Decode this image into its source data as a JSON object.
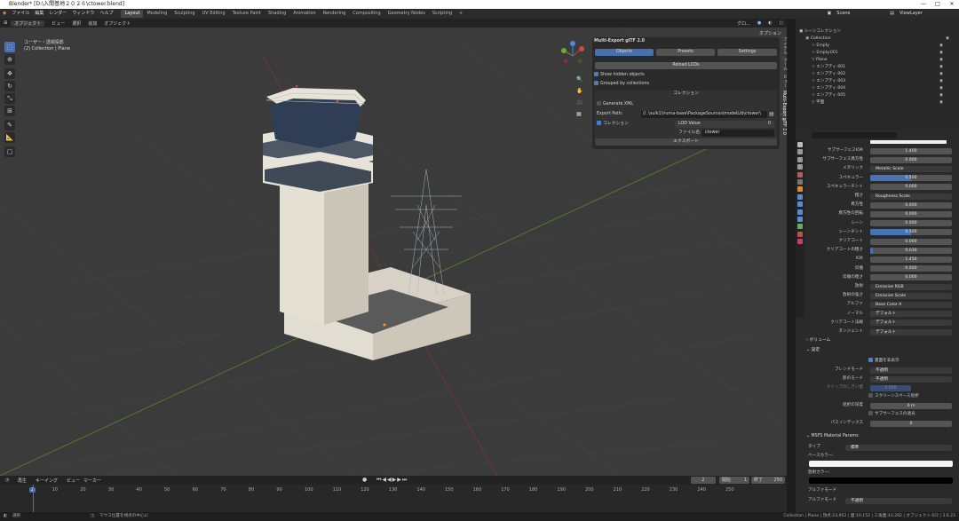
{
  "titlebar": {
    "title": "Blender* [D:\\入間基地２０２６\\ctower.blend]",
    "min": "—",
    "max": "□",
    "close": "✕"
  },
  "menu": [
    "ファイル",
    "編集",
    "レンダー",
    "ウィンドウ",
    "ヘルプ"
  ],
  "workspaces": [
    "Layout",
    "Modeling",
    "Sculpting",
    "UV Editing",
    "Texture Paint",
    "Shading",
    "Animation",
    "Rendering",
    "Compositing",
    "Geometry Nodes",
    "Scripting",
    "+"
  ],
  "scene": {
    "name": "Scene",
    "view_layer": "ViewLayer"
  },
  "viewport_header": [
    "オブジェクト",
    "ビュー",
    "選択",
    "追加",
    "オブジェクト"
  ],
  "viewport_header_right": {
    "transform": "グロ...",
    "options": "オプション"
  },
  "viewport_info": {
    "view": "ユーザー・透視投影",
    "collection": "(2) Collection | Plane"
  },
  "multi_export": {
    "title": "Multi-Export glTF 2.0",
    "tabs": [
      "Objects",
      "Presets",
      "Settings"
    ],
    "reload": "Reload LODs",
    "show_hidden": "Show hidden objects",
    "grouped": "Grouped by collections",
    "section": "コレクション",
    "generate_xml": "Generate XML",
    "export_path_label": "Export Path:",
    "export_path": "//..\\sulk1\\iruma-base\\PackageSources\\modelLib\\ctower\\",
    "collection_label": "コレクション",
    "lod_label": "LOD Value",
    "lod_value": "0",
    "filename_label": "ファイル名:",
    "filename": "ctower",
    "export_btn": "エクスポート"
  },
  "side_tabs": [
    "アイテム",
    "ツール",
    "ビュー",
    "Multi-Export glTF 2.0"
  ],
  "outliner": {
    "header": "シーンコレクション",
    "rows": [
      {
        "label": "Collection",
        "color": "#ccc"
      },
      {
        "label": "Empty",
        "color": "#ccc"
      },
      {
        "label": "Empty.001",
        "color": "#ccc"
      },
      {
        "label": "Plane",
        "color": "#e0e0e0"
      },
      {
        "label": "エンプティ.001",
        "color": "#ccc"
      },
      {
        "label": "エンプティ.002",
        "color": "#ccc"
      },
      {
        "label": "エンプティ.003",
        "color": "#ccc"
      },
      {
        "label": "エンプティ.004",
        "color": "#ccc"
      },
      {
        "label": "エンプティ.005",
        "color": "#ccc"
      },
      {
        "label": "平面",
        "color": "#e0e0e0"
      }
    ]
  },
  "props": {
    "rows": [
      {
        "label": "サブサーフェスIOR",
        "value": "1.400",
        "fill": 0
      },
      {
        "label": "サブサーフェス異方性",
        "value": "0.000",
        "fill": 0
      },
      {
        "label": "メタリック",
        "value": "Metallic Scale",
        "dark": true
      },
      {
        "label": "スペキュラー",
        "value": "0.500",
        "fill": 0.5
      },
      {
        "label": "スペキュラーチント",
        "value": "0.000",
        "fill": 0
      },
      {
        "label": "粗さ",
        "value": "Roughness Scale",
        "dark": true
      },
      {
        "label": "異方性",
        "value": "0.000",
        "fill": 0
      },
      {
        "label": "異方性の回転",
        "value": "0.000",
        "fill": 0
      },
      {
        "label": "シーン",
        "value": "0.000",
        "fill": 0
      },
      {
        "label": "シーンチント",
        "value": "0.500",
        "fill": 0.5
      },
      {
        "label": "クリアコート",
        "value": "0.000",
        "fill": 0
      },
      {
        "label": "クリアコートの粗さ",
        "value": "0.030",
        "fill": 0.03
      },
      {
        "label": "IOR",
        "value": "1.450",
        "fill": 0
      },
      {
        "label": "伝播",
        "value": "0.000",
        "fill": 0
      },
      {
        "label": "伝播の粗さ",
        "value": "0.000",
        "fill": 0
      },
      {
        "label": "放射",
        "value": "Emissive RGB",
        "dark": true
      },
      {
        "label": "放射の強さ",
        "value": "Emissive Scale",
        "dark": true
      },
      {
        "label": "アルファ",
        "value": "Base Color A",
        "dark": true
      },
      {
        "label": "ノーマル",
        "value": "デフォルト",
        "dark": true
      },
      {
        "label": "クリアコート法線",
        "value": "デフォルト",
        "dark": true
      },
      {
        "label": "タンジェント",
        "value": "デフォルト",
        "dark": true
      }
    ],
    "volume": "ボリューム",
    "settings": "設定",
    "backface": "裏面を非表示",
    "blend_mode_label": "ブレンドモード",
    "blend_mode": "不透明",
    "shadow_mode_label": "影のモード",
    "shadow_mode": "不透明",
    "clip_label": "クリップのしきい値",
    "clip": "0.500",
    "screen_space": "スクリーンスペース屈折",
    "refraction_depth_label": "屈折の深度",
    "refraction_depth": "0 m",
    "subsurface_trans": "サブサーフェスの透光",
    "pass_index_label": "パスインデックス",
    "pass_index": "0",
    "msfs_title": "MSFS Material Params",
    "type_label": "タイプ",
    "type_value": "標準",
    "base_color_label": "ベースカラー:",
    "emissive_label": "放射カラー:",
    "alpha_mode_label": "アルファモード",
    "alpha_mode_value": "不透明"
  },
  "timeline": {
    "menu": [
      "再生",
      "キーイング",
      "ビュー",
      "マーカー"
    ],
    "current": "2",
    "start_label": "開始",
    "start": "1",
    "end_label": "終了",
    "end": "250",
    "ticks": [
      "2",
      "10",
      "20",
      "30",
      "40",
      "50",
      "60",
      "70",
      "80",
      "90",
      "100",
      "110",
      "120",
      "130",
      "140",
      "150",
      "160",
      "170",
      "180",
      "190",
      "200",
      "210",
      "220",
      "230",
      "240",
      "250"
    ]
  },
  "status": {
    "left": "選択",
    "mid": "マウス位置を視点の中心に",
    "right": "Collection | Plane | 頂点:23,952 | 面:19,152 | 三角面:43,282 | オブジェクト:0/2 | 3.6.23"
  }
}
